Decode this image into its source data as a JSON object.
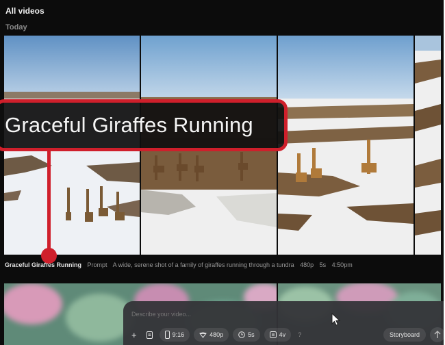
{
  "header": {
    "title": "All videos"
  },
  "section": {
    "label": "Today"
  },
  "video": {
    "title": "Graceful Giraffes Running",
    "prompt_label": "Prompt",
    "prompt": "A wide, serene shot of a family of giraffes running through a tundra",
    "resolution": "480p",
    "duration": "5s",
    "time": "4:50pm"
  },
  "callout": {
    "text": "Graceful Giraffes Running"
  },
  "composer": {
    "placeholder": "Describe your video...",
    "plus": "+",
    "aspect": "9:16",
    "resolution": "480p",
    "duration": "5s",
    "variations": "4v",
    "help": "?",
    "storyboard": "Storyboard"
  },
  "colors": {
    "callout": "#cf1f2b",
    "background": "#0c0c0c"
  },
  "icons": [
    "storyboard-doc-icon",
    "phone-aspect-icon",
    "quality-icon",
    "clock-icon",
    "variations-icon",
    "send-arrow-icon",
    "cursor-icon"
  ]
}
